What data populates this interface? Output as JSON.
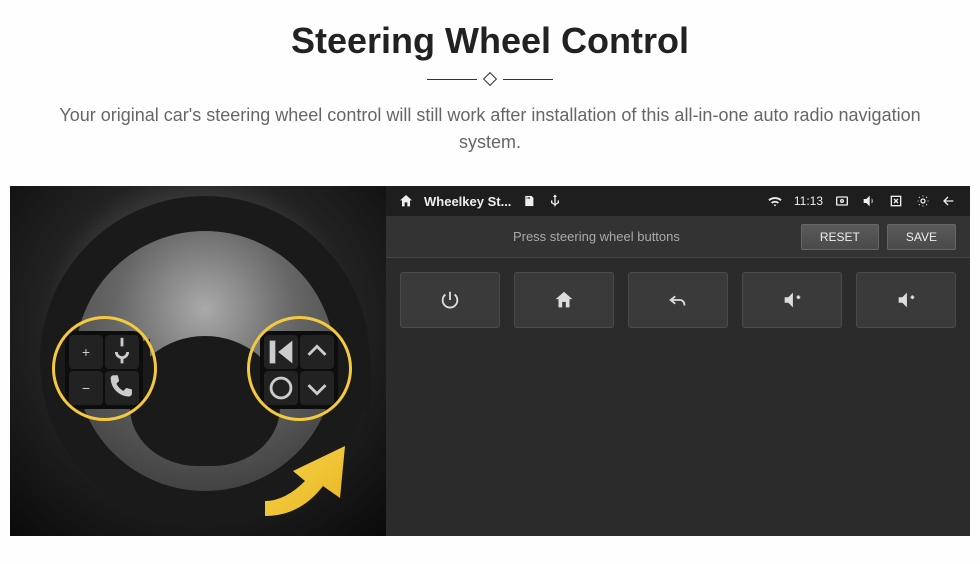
{
  "header": {
    "title": "Steering Wheel Control",
    "subtitle": "Your original car's steering wheel control will still work after installation of this all-in-one auto radio navigation system."
  },
  "statusBar": {
    "appTitle": "Wheelkey St...",
    "time": "11:13"
  },
  "instructionBar": {
    "text": "Press steering wheel buttons",
    "resetLabel": "RESET",
    "saveLabel": "SAVE"
  },
  "wheelButtons": {
    "left": {
      "topLeft": "+",
      "topRight": "voice",
      "bottomLeft": "−",
      "bottomRight": "phone"
    },
    "right": {
      "topLeft": "next",
      "topRight": "up",
      "bottomLeft": "source",
      "bottomRight": "down"
    }
  },
  "keyGrid": [
    {
      "name": "power",
      "icon": "power"
    },
    {
      "name": "home",
      "icon": "home"
    },
    {
      "name": "back",
      "icon": "back"
    },
    {
      "name": "volume-up-1",
      "icon": "volume-up"
    },
    {
      "name": "volume-up-2",
      "icon": "volume-up"
    }
  ]
}
